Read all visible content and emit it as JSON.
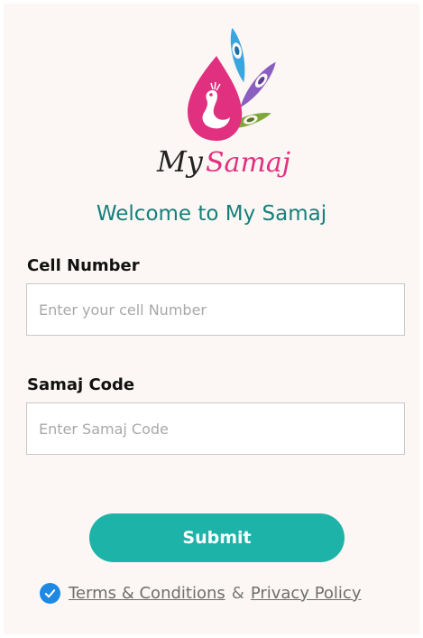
{
  "brand": {
    "logo_text_1": "My",
    "logo_text_2": "Samaj",
    "welcome": "Welcome to My Samaj"
  },
  "form": {
    "cell_label": "Cell Number",
    "cell_placeholder": "Enter your cell Number",
    "cell_value": "",
    "code_label": "Samaj Code",
    "code_placeholder": "Enter Samaj Code",
    "code_value": "",
    "submit_label": "Submit"
  },
  "terms": {
    "checked": true,
    "terms_link": "Terms & Conditions",
    "separator": "&",
    "privacy_link": "Privacy Policy"
  },
  "icons": {
    "logo": "peacock-logo-icon",
    "checkbox": "check-circle-icon"
  },
  "colors": {
    "accent": "#1db3a8",
    "welcome_text": "#16807a",
    "logo_pink": "#e0307f",
    "check_blue": "#1e88e5",
    "background": "#fcf7f4"
  }
}
